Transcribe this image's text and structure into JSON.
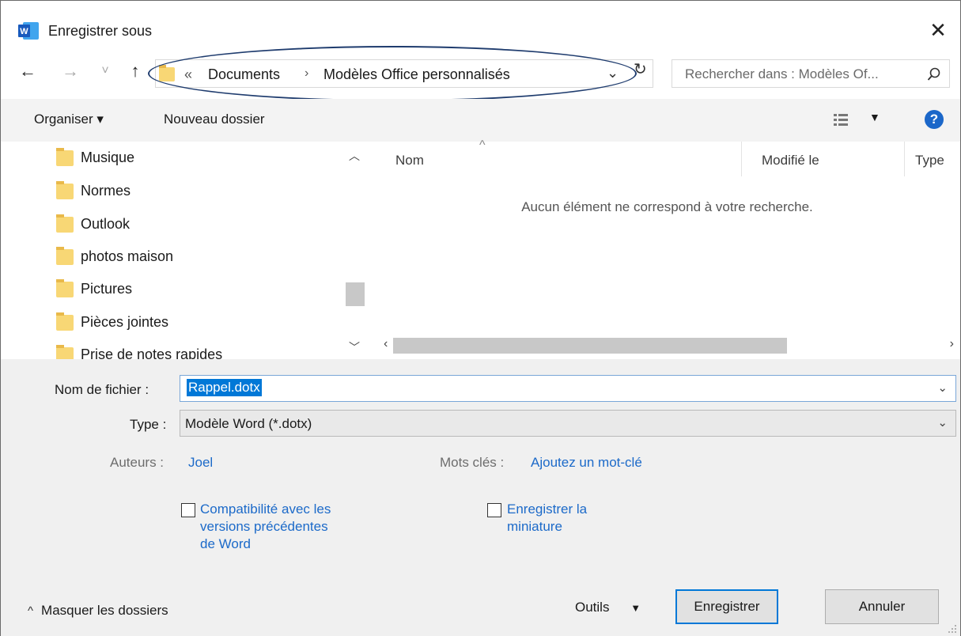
{
  "window": {
    "title": "Enregistrer sous",
    "close": "✕",
    "app_icon_letter": "W"
  },
  "nav": {
    "back": "←",
    "forward": "→",
    "recent": "˅",
    "up": "↑",
    "path_prefix": "«",
    "breadcrumb": [
      "Documents",
      "Modèles Office personnalisés"
    ],
    "breadcrumb_sep": "›",
    "dropdown": "⌄",
    "refresh": "↻",
    "search_placeholder": "Rechercher dans : Modèles Of..."
  },
  "toolbar": {
    "organize": "Organiser ▾",
    "new_folder": "Nouveau dossier",
    "view_caret": "▼",
    "help": "?"
  },
  "tree": {
    "items": [
      "Musique",
      "Normes",
      "Outlook",
      "photos maison",
      "Pictures",
      "Pièces jointes",
      "Prise de notes rapides"
    ]
  },
  "list": {
    "columns": [
      "Nom",
      "Modifié le",
      "Type"
    ],
    "sort_arrow": "^",
    "empty_message": "Aucun élément ne correspond à votre recherche."
  },
  "form": {
    "filename_label": "Nom de fichier :",
    "filename_value": "Rappel.dotx",
    "type_label": "Type :",
    "type_value": "Modèle Word (*.dotx)",
    "authors_label": "Auteurs :",
    "authors_value": "Joel",
    "keywords_label": "Mots clés :",
    "keywords_value": "Ajoutez un mot-clé",
    "compat_lines": [
      "Compatibilité avec les",
      "versions précédentes",
      "de Word"
    ],
    "thumb_lines": [
      "Enregistrer la",
      "miniature"
    ],
    "compat_checked": false,
    "thumb_checked": false
  },
  "footer": {
    "hide_folders": "Masquer les dossiers",
    "hide_caret": "^",
    "tools": "Outils",
    "tools_caret": "▼",
    "save": "Enregistrer",
    "cancel": "Annuler"
  },
  "colors": {
    "link": "#1c6ac9",
    "selection": "#0078d7",
    "annotation": "#1f3c6e",
    "folder": "#f8d775"
  }
}
